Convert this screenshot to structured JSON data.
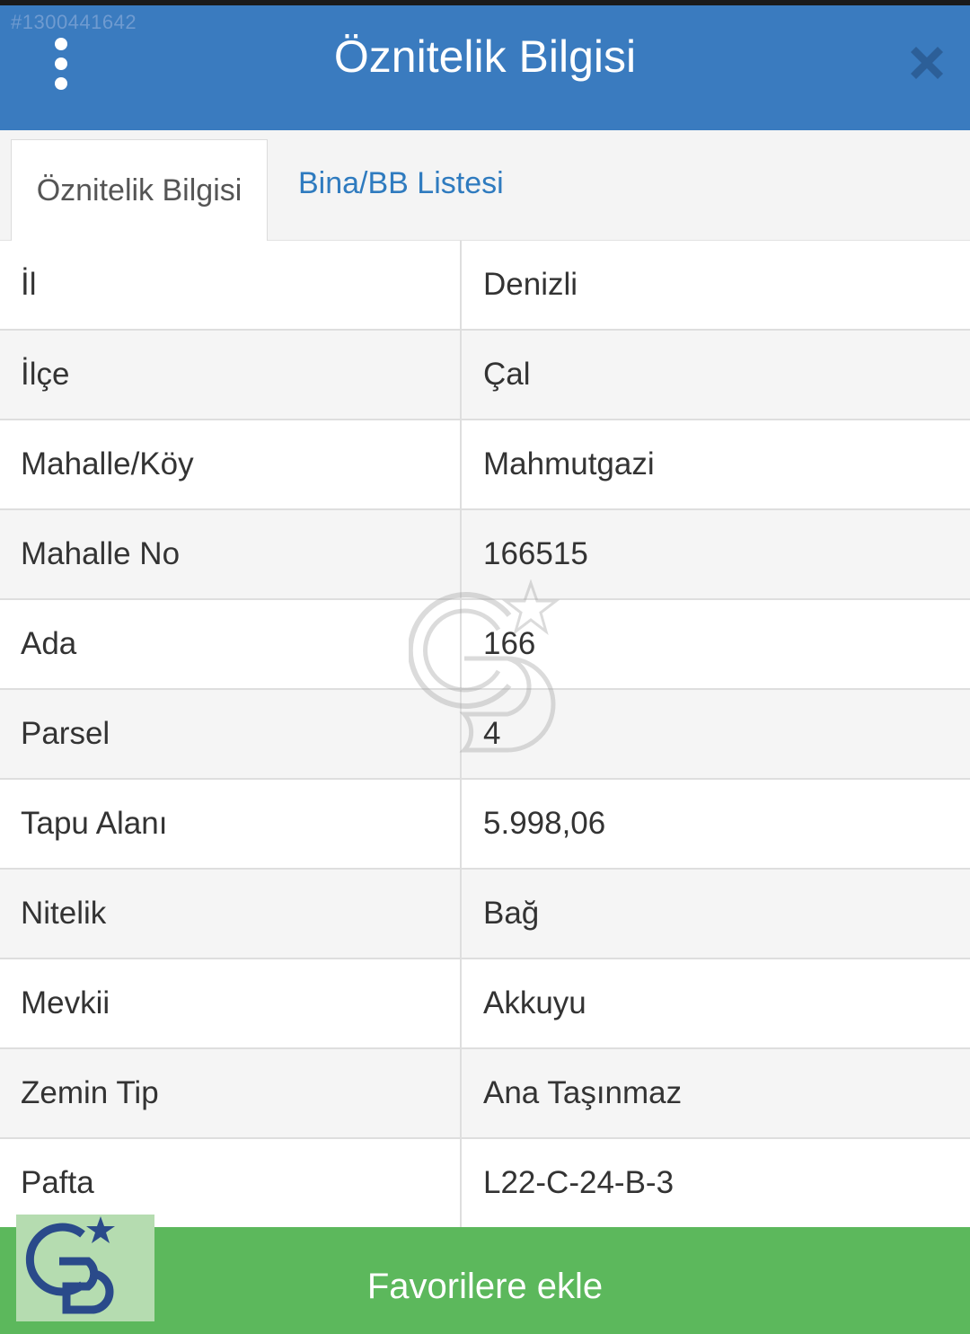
{
  "header": {
    "watermark_id": "#1300441642",
    "title": "Öznitelik Bilgisi",
    "menu_icon": "vertical-dots-icon",
    "close_icon": "close-icon"
  },
  "tabs": [
    {
      "label": "Öznitelik Bilgisi",
      "active": true
    },
    {
      "label": "Bina/BB Listesi",
      "active": false
    }
  ],
  "rows": [
    {
      "label": "İl",
      "value": "Denizli"
    },
    {
      "label": "İlçe",
      "value": "Çal"
    },
    {
      "label": "Mahalle/Köy",
      "value": "Mahmutgazi"
    },
    {
      "label": "Mahalle No",
      "value": "166515"
    },
    {
      "label": "Ada",
      "value": "166"
    },
    {
      "label": "Parsel",
      "value": "4"
    },
    {
      "label": "Tapu Alanı",
      "value": "5.998,06"
    },
    {
      "label": "Nitelik",
      "value": "Bağ"
    },
    {
      "label": "Mevkii",
      "value": "Akkuyu"
    },
    {
      "label": "Zemin Tip",
      "value": "Ana Taşınmaz"
    },
    {
      "label": "Pafta",
      "value": "L22-C-24-B-3"
    }
  ],
  "footer": {
    "button_label": "Favorilere ekle"
  },
  "colors": {
    "header_bg": "#3a7bbf",
    "tab_link": "#2f7bbf",
    "footer_bg": "#5cb85c",
    "logo_blue": "#2a4a8a"
  }
}
